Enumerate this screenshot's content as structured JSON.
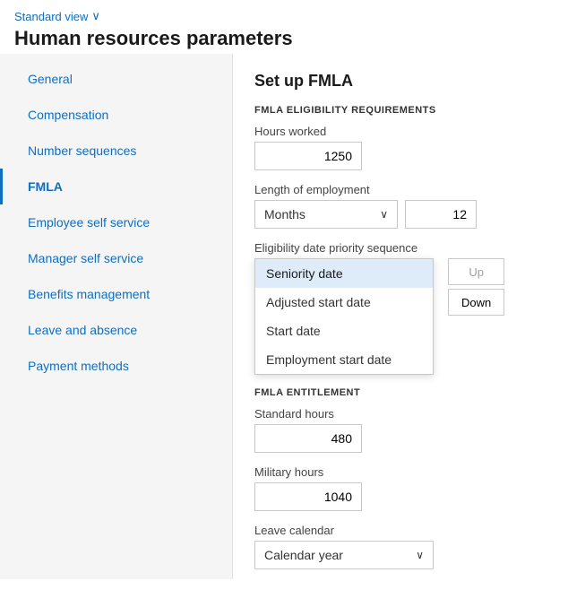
{
  "topBar": {
    "standardView": "Standard view",
    "chevron": "∨",
    "pageTitle": "Human resources parameters"
  },
  "sidebar": {
    "items": [
      {
        "id": "general",
        "label": "General",
        "active": false
      },
      {
        "id": "compensation",
        "label": "Compensation",
        "active": false
      },
      {
        "id": "number-sequences",
        "label": "Number sequences",
        "active": false
      },
      {
        "id": "fmla",
        "label": "FMLA",
        "active": true
      },
      {
        "id": "employee-self-service",
        "label": "Employee self service",
        "active": false
      },
      {
        "id": "manager-self-service",
        "label": "Manager self service",
        "active": false
      },
      {
        "id": "benefits-management",
        "label": "Benefits management",
        "active": false
      },
      {
        "id": "leave-and-absence",
        "label": "Leave and absence",
        "active": false
      },
      {
        "id": "payment-methods",
        "label": "Payment methods",
        "active": false
      }
    ]
  },
  "content": {
    "sectionTitle": "Set up FMLA",
    "eligibilitySection": {
      "label": "FMLA ELIGIBILITY REQUIREMENTS",
      "hoursWorked": {
        "label": "Hours worked",
        "value": "1250"
      },
      "lengthOfEmployment": {
        "label": "Length of employment",
        "dropdownValue": "Months",
        "dropdownArrow": "∨",
        "inputValue": "12"
      },
      "prioritySequence": {
        "label": "Eligibility date priority sequence",
        "options": [
          {
            "id": "seniority-date",
            "label": "Seniority date",
            "highlighted": true
          },
          {
            "id": "adjusted-start-date",
            "label": "Adjusted start date",
            "highlighted": false
          },
          {
            "id": "start-date",
            "label": "Start date",
            "highlighted": false
          },
          {
            "id": "employment-start-date",
            "label": "Employment start date",
            "highlighted": false
          }
        ],
        "upButton": "Up",
        "downButton": "Down"
      }
    },
    "entitlementSection": {
      "label": "FMLA ENTITLEMENT",
      "standardHours": {
        "label": "Standard hours",
        "value": "480"
      },
      "militaryHours": {
        "label": "Military hours",
        "value": "1040"
      },
      "leaveCalendar": {
        "label": "Leave calendar",
        "value": "Calendar year",
        "arrow": "∨"
      }
    }
  }
}
